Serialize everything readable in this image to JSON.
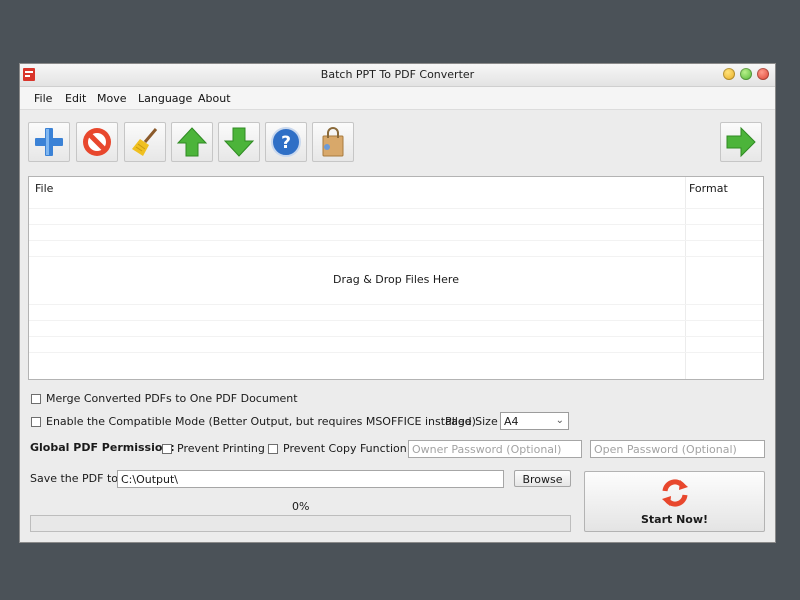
{
  "window": {
    "title": "Batch PPT To PDF Converter"
  },
  "menu": {
    "items": [
      "File",
      "Edit",
      "Move",
      "Language",
      "About"
    ]
  },
  "toolbar": {
    "buttons": [
      {
        "icon": "add-icon"
      },
      {
        "icon": "remove-icon"
      },
      {
        "icon": "broom-icon"
      },
      {
        "icon": "arrow-up-icon"
      },
      {
        "icon": "arrow-down-icon"
      },
      {
        "icon": "help-icon"
      },
      {
        "icon": "shopping-bag-icon"
      }
    ],
    "right_button": {
      "icon": "arrow-right-icon"
    }
  },
  "file_list": {
    "columns": [
      "File",
      "Format"
    ],
    "rows": [],
    "placeholder": "Drag & Drop Files Here"
  },
  "options": {
    "merge_label": "Merge Converted PDFs to One PDF Document",
    "merge_checked": false,
    "compat_label": "Enable the Compatible Mode (Better Output, but requires MSOFFICE installed)",
    "compat_checked": false,
    "page_size_label": "Page Size",
    "page_size_value": "A4"
  },
  "permissions": {
    "label": "Global PDF Permission:",
    "prevent_printing_label": "Prevent Printing",
    "prevent_printing_checked": false,
    "prevent_copy_label": "Prevent Copy Function",
    "prevent_copy_checked": false,
    "owner_password_placeholder": "Owner Password (Optional)",
    "open_password_placeholder": "Open Password (Optional)"
  },
  "output": {
    "save_label": "Save the PDF to",
    "path_value": "C:\\Output\\",
    "browse_label": "Browse"
  },
  "progress": {
    "text": "0%",
    "fraction": 0
  },
  "start_button": {
    "label": "Start Now!",
    "icon": "refresh-icon"
  },
  "colors": {
    "accent_red": "#e8472d",
    "arrow_green": "#4cb43a",
    "add_blue": "#3b82d6"
  }
}
